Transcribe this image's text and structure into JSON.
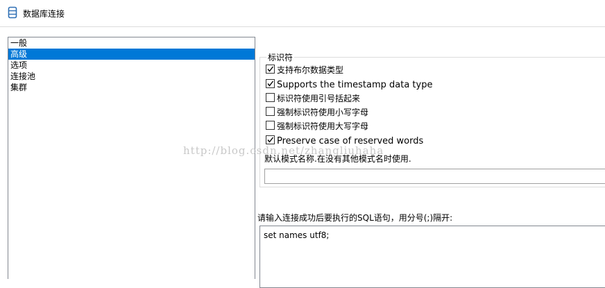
{
  "window": {
    "title": "数据库连接",
    "icon": "database-icon"
  },
  "nav": {
    "items": [
      {
        "label": "一般",
        "selected": false
      },
      {
        "label": "高级",
        "selected": true
      },
      {
        "label": "选项",
        "selected": false
      },
      {
        "label": "连接池",
        "selected": false
      },
      {
        "label": "集群",
        "selected": false
      }
    ]
  },
  "identifiers": {
    "legend": "标识符",
    "options": [
      {
        "label": "支持布尔数据类型",
        "checked": true
      },
      {
        "label": "Supports the timestamp data type",
        "checked": true
      },
      {
        "label": "标识符使用引号括起来",
        "checked": false
      },
      {
        "label": "强制标识符使用小写字母",
        "checked": false
      },
      {
        "label": "强制标识符使用大写字母",
        "checked": false
      },
      {
        "label": "Preserve case of reserved words",
        "checked": true
      }
    ],
    "default_schema_label": "默认模式名称.在没有其他模式名时使用.",
    "default_schema_value": ""
  },
  "sql": {
    "label": "请输入连接成功后要执行的SQL语句，用分号(;)隔开:",
    "value": "set names utf8;"
  },
  "watermark": "http://blog.csdn.net/zhangliuhaha",
  "colors": {
    "selection": "#0078d7",
    "border": "#828790",
    "group_border": "#dcdcdc"
  }
}
